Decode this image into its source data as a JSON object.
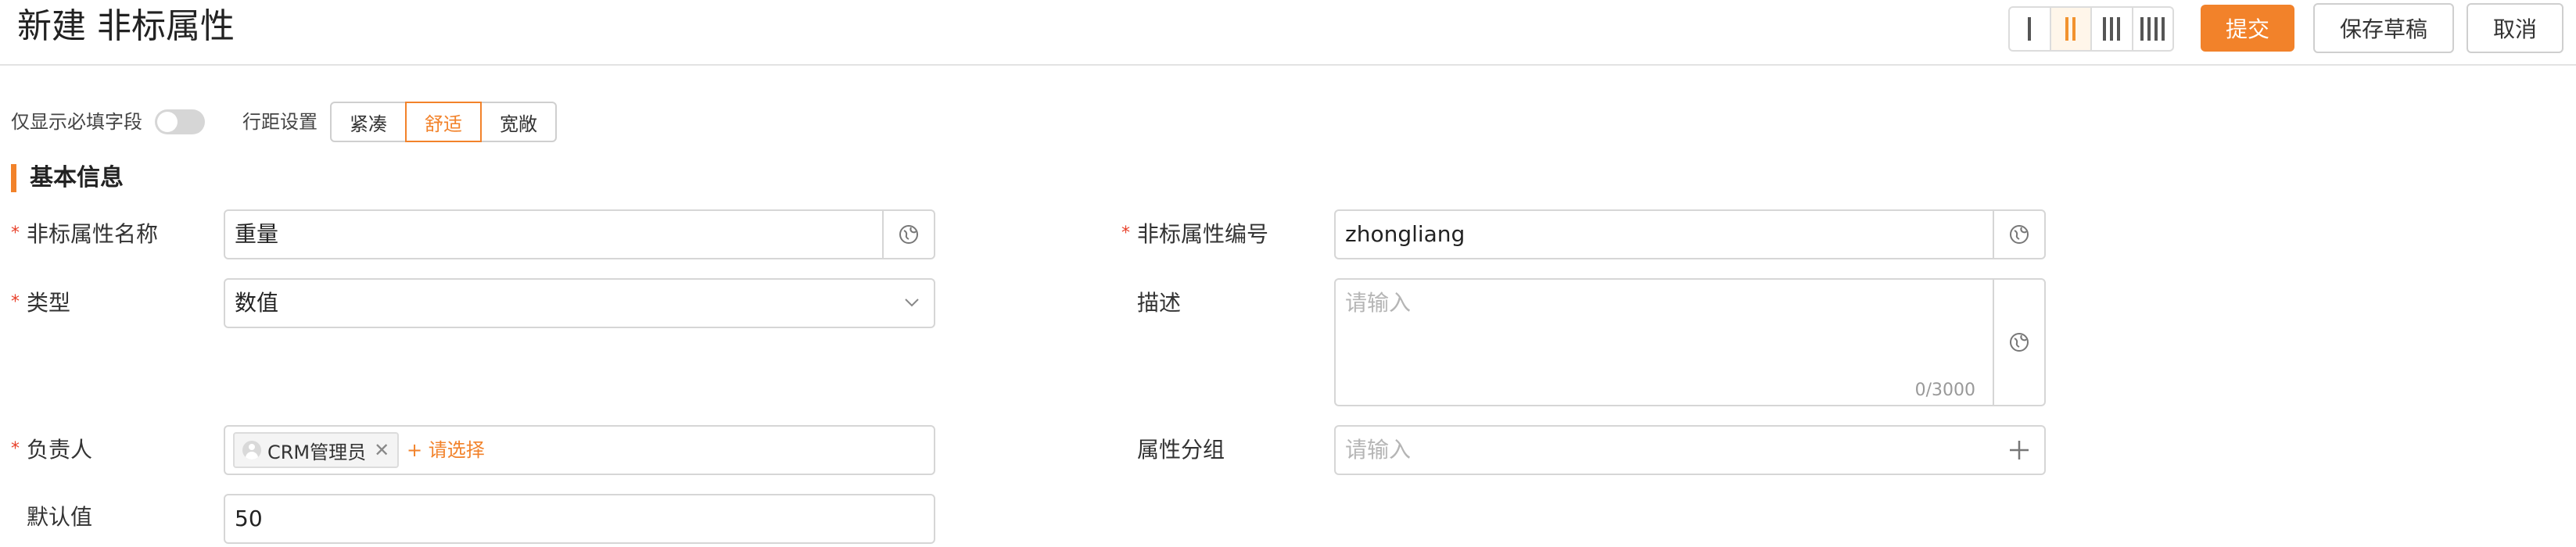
{
  "header": {
    "title": "新建 非标属性",
    "submit_label": "提交",
    "save_draft_label": "保存草稿",
    "cancel_label": "取消",
    "column_layout": {
      "options": [
        1,
        2,
        3,
        4
      ],
      "selected": 2
    }
  },
  "toolbar": {
    "required_only_label": "仅显示必填字段",
    "required_only_on": false,
    "row_spacing_label": "行距设置",
    "spacing_options": [
      "紧凑",
      "舒适",
      "宽敞"
    ],
    "spacing_selected": "舒适"
  },
  "section": {
    "title": "基本信息"
  },
  "fields": {
    "name": {
      "label": "非标属性名称",
      "value": "重量",
      "required": true
    },
    "code": {
      "label": "非标属性编号",
      "value": "zhongliang",
      "required": true
    },
    "type": {
      "label": "类型",
      "value": "数值",
      "required": true
    },
    "description": {
      "label": "描述",
      "placeholder": "请输入",
      "counter": "0/3000",
      "required": false
    },
    "owner": {
      "label": "负责人",
      "tag": "CRM管理员",
      "add_label": "+ 请选择",
      "required": true
    },
    "group": {
      "label": "属性分组",
      "placeholder": "请输入",
      "required": false
    },
    "default": {
      "label": "默认值",
      "value": "50",
      "required": false
    }
  },
  "required_mark": "*",
  "colors": {
    "accent": "#f2822a",
    "required": "#e8402a",
    "border": "#d6d6d6"
  }
}
